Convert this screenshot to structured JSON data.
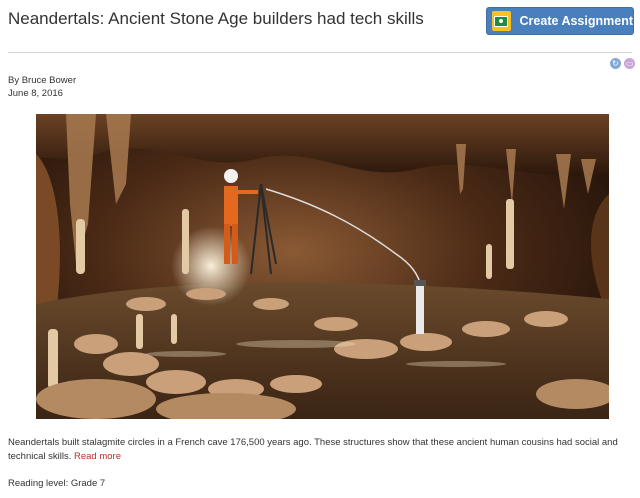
{
  "article": {
    "title": "Neandertals: Ancient Stone Age builders had tech skills",
    "byline": "By Bruce Bower",
    "date": "June 8, 2016",
    "description": "Neandertals built stalagmite circles in a French cave 176,500 years ago. These structures show that these ancient human cousins had social and technical skills.",
    "read_more": "Read more",
    "reading_level": "Reading level: Grade 7"
  },
  "toolbar": {
    "create_assignment_label": "Create Assignment",
    "button_color": "#4a7fbd"
  },
  "icons": {
    "assignment": "google-classroom-icon",
    "tool_1": "translate-icon",
    "tool_2": "print-icon"
  }
}
